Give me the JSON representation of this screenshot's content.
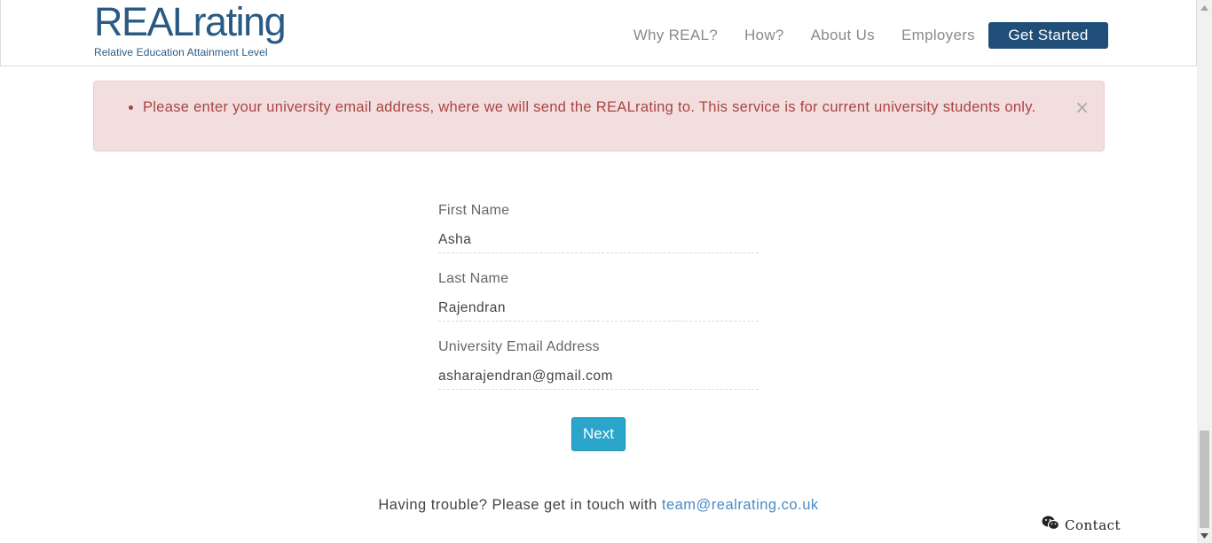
{
  "header": {
    "logo": {
      "bold": "REAL",
      "thin": "rating"
    },
    "tagline": "Relative Education Attainment Level",
    "nav": [
      {
        "label": "Why REAL?"
      },
      {
        "label": "How?"
      },
      {
        "label": "About Us"
      },
      {
        "label": "Employers"
      }
    ],
    "cta_label": "Get Started"
  },
  "alert": {
    "message": "Please enter your university email address, where we will send the REALrating to. This service is for current university students only.",
    "close_glyph": "×"
  },
  "form": {
    "first_name": {
      "label": "First Name",
      "value": "Asha"
    },
    "last_name": {
      "label": "Last Name",
      "value": "Rajendran"
    },
    "email": {
      "label": "University Email Address",
      "value": "asharajendran@gmail.com"
    },
    "next_label": "Next"
  },
  "help": {
    "text": "Having trouble? Please get in touch with ",
    "email": "team@realrating.co.uk"
  },
  "contact_label": "Contact",
  "colors": {
    "brand": "#2a5a84",
    "cta": "#1f4e78",
    "alert_bg": "#f2dede",
    "alert_text": "#a94442",
    "next_button": "#2ba6cb",
    "link": "#4a8bc2"
  }
}
